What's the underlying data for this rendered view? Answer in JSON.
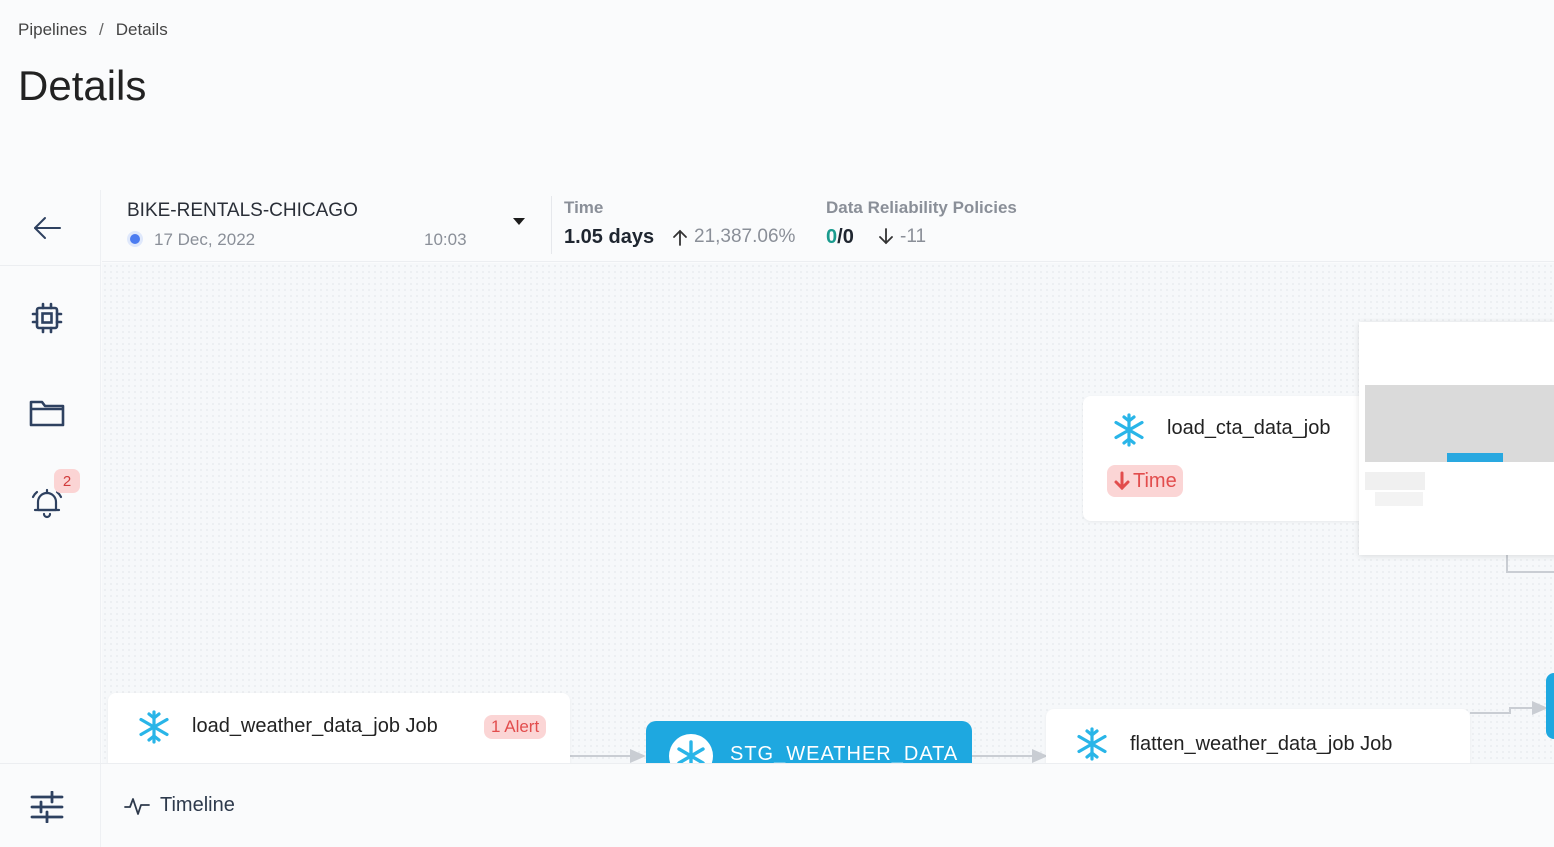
{
  "breadcrumb": {
    "root": "Pipelines",
    "separator": "/",
    "current": "Details"
  },
  "page_title": "Details",
  "sidebar": {
    "items": [
      {
        "icon": "arrow-left-icon"
      },
      {
        "icon": "cpu-icon"
      },
      {
        "icon": "folder-icon"
      },
      {
        "icon": "alarm-bell-icon",
        "badge": "2"
      }
    ],
    "bottom_icon": "sliders-icon"
  },
  "header": {
    "pipeline_name": "BIKE-RENTALS-CHICAGO",
    "run_date": "17 Dec, 2022",
    "run_time": "10:03",
    "time_label": "Time",
    "time_value": "1.05 days",
    "time_change": "21,387.06%",
    "policies_label": "Data Reliability Policies",
    "policies_value_a": "0",
    "policies_value_sep": "/",
    "policies_value_b": "0",
    "policies_change": "-11"
  },
  "graph": {
    "node_cta": {
      "title": "load_cta_data_job",
      "tag": "Time"
    },
    "node_weather": {
      "title": "load_weather_data_job Job",
      "alert": "1 Alert"
    },
    "node_stg": {
      "title": "STG_WEATHER_DATA"
    },
    "node_flatten": {
      "title": "flatten_weather_data_job Job"
    }
  },
  "timeline": {
    "label": "Timeline"
  },
  "colors": {
    "accent": "#1ea8e0",
    "alert": "#e24d4d",
    "alert_bg": "#fbd5d5",
    "good": "#1a9b8e"
  }
}
